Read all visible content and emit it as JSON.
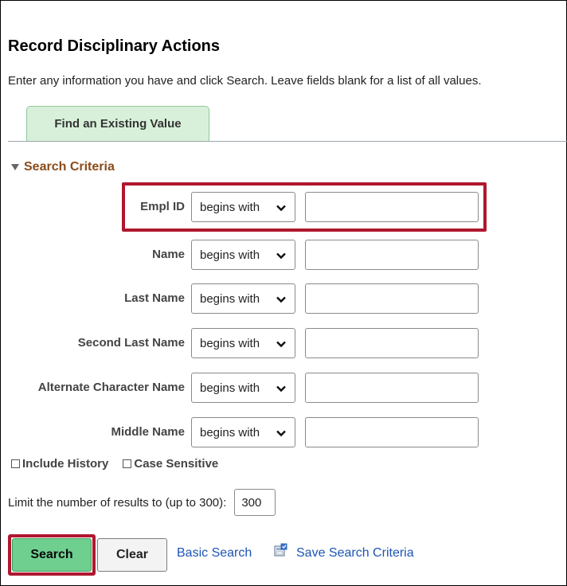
{
  "page": {
    "title": "Record Disciplinary Actions",
    "instructions": "Enter any information you have and click Search. Leave fields blank for a list of all values."
  },
  "tabs": {
    "active_label": "Find an Existing Value"
  },
  "search_criteria": {
    "section_label": "Search Criteria",
    "fields": [
      {
        "label": "Empl ID",
        "operator": "begins with",
        "value": ""
      },
      {
        "label": "Name",
        "operator": "begins with",
        "value": ""
      },
      {
        "label": "Last Name",
        "operator": "begins with",
        "value": ""
      },
      {
        "label": "Second Last Name",
        "operator": "begins with",
        "value": ""
      },
      {
        "label": "Alternate Character Name",
        "operator": "begins with",
        "value": ""
      },
      {
        "label": "Middle Name",
        "operator": "begins with",
        "value": ""
      }
    ],
    "include_history_label": "Include History",
    "include_history_checked": false,
    "case_sensitive_label": "Case Sensitive",
    "case_sensitive_checked": false,
    "limit_label": "Limit the number of results to (up to 300):",
    "limit_value": "300"
  },
  "actions": {
    "search_label": "Search",
    "clear_label": "Clear",
    "basic_search_label": "Basic Search",
    "save_search_label": "Save Search Criteria"
  },
  "colors": {
    "title_text": "#000000",
    "section_text": "#8a4b1a",
    "tab_bg": "#d8f0da",
    "search_button_bg": "#6fcf8f",
    "highlight_border": "#b0172f",
    "link_text": "#1d55b3"
  },
  "icons": {
    "section_toggle": "triangle-down-icon",
    "select_arrow": "chevron-down-icon",
    "save_search": "save-criteria-icon"
  }
}
